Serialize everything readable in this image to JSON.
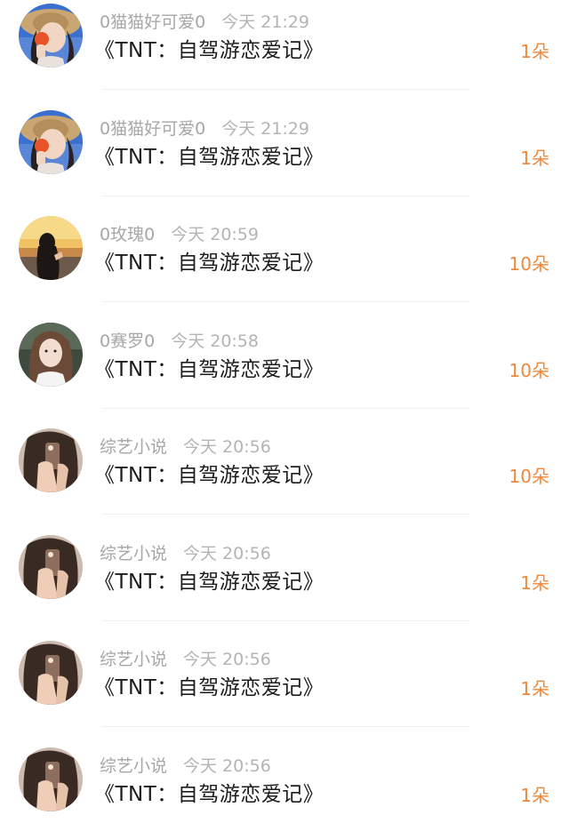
{
  "rows": [
    {
      "name": "0猫猫好可爱0",
      "time": "今天 21:29",
      "title": "《TNT：自驾游恋爱记》",
      "amount": "1朵",
      "avatar_icon": "avatar-girl-straw-hat"
    },
    {
      "name": "0猫猫好可爱0",
      "time": "今天 21:29",
      "title": "《TNT：自驾游恋爱记》",
      "amount": "1朵",
      "avatar_icon": "avatar-girl-straw-hat"
    },
    {
      "name": "0玫瑰0",
      "time": "今天 20:59",
      "title": "《TNT：自驾游恋爱记》",
      "amount": "10朵",
      "avatar_icon": "avatar-girl-sunset"
    },
    {
      "name": "0赛罗0",
      "time": "今天 20:58",
      "title": "《TNT：自驾游恋爱记》",
      "amount": "10朵",
      "avatar_icon": "avatar-girl-portrait"
    },
    {
      "name": "综艺小说",
      "time": "今天 20:56",
      "title": "《TNT：自驾游恋爱记》",
      "amount": "10朵",
      "avatar_icon": "avatar-girl-phone-selfie"
    },
    {
      "name": "综艺小说",
      "time": "今天 20:56",
      "title": "《TNT：自驾游恋爱记》",
      "amount": "1朵",
      "avatar_icon": "avatar-girl-phone-selfie"
    },
    {
      "name": "综艺小说",
      "time": "今天 20:56",
      "title": "《TNT：自驾游恋爱记》",
      "amount": "1朵",
      "avatar_icon": "avatar-girl-phone-selfie"
    },
    {
      "name": "综艺小说",
      "time": "今天 20:56",
      "title": "《TNT：自驾游恋爱记》",
      "amount": "1朵",
      "avatar_icon": "avatar-girl-phone-selfie"
    }
  ],
  "colors": {
    "name_text": "#a7a7a7",
    "time_text": "#b4b4b4",
    "title_text": "#1d1d1d",
    "amount_accent": "#f0883a",
    "divider": "#f1f1f1"
  }
}
